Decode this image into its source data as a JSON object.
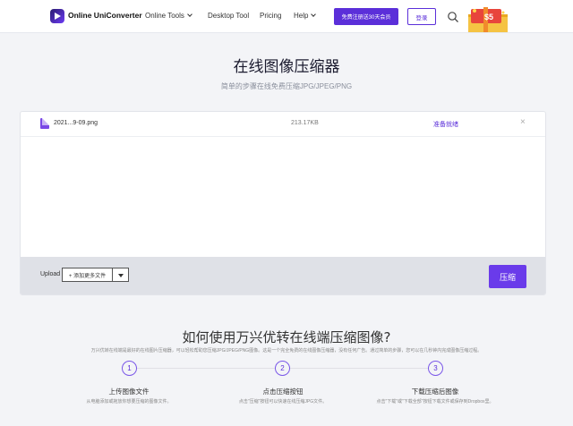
{
  "header": {
    "brand": "Online UniConverter",
    "nav": [
      {
        "label": "Online Tools"
      },
      {
        "label": "Desktop Tool"
      },
      {
        "label": "Pricing"
      },
      {
        "label": "Help"
      }
    ],
    "cta_label": "免费注册送30天会员",
    "login_label": "登录",
    "gift_text": "$5",
    "accent_color": "#5b2fd9"
  },
  "hero": {
    "title": "在线图像压缩器",
    "subtitle": "简单的步骤在线免费压缩JPG/JPEG/PNG"
  },
  "file_list": [
    {
      "name": "2021...9-09.png",
      "size": "213.17KB",
      "status": "准备就绪"
    }
  ],
  "uploader": {
    "upload_label": "Upload",
    "add_button": "+ 添加更多文件",
    "compress_button": "压缩"
  },
  "how_to": {
    "title": "如何使用万兴优转在线端压缩图像?",
    "description": "万兴优转在线端是最好的在线图片压缩器，可以轻松帮助您压缩JPG/JPEG/PNG图像。这是一个完全免费的在线图像压缩器，没有任何广告。通过简单的步骤，您可以在几秒钟内完成图像压缩过程。",
    "steps": [
      {
        "number": "1",
        "title": "上传图像文件",
        "desc": "从电脑添加或拖放你想要压缩的图像文件。"
      },
      {
        "number": "2",
        "title": "点击压缩按钮",
        "desc": "点击\"压缩\"按钮可以快速在线压缩JPG文件。"
      },
      {
        "number": "3",
        "title": "下载压缩后图像",
        "desc": "点击\"下载\"或\"下载全部\"按钮下载文件或保存到Dropbox里。"
      }
    ]
  }
}
